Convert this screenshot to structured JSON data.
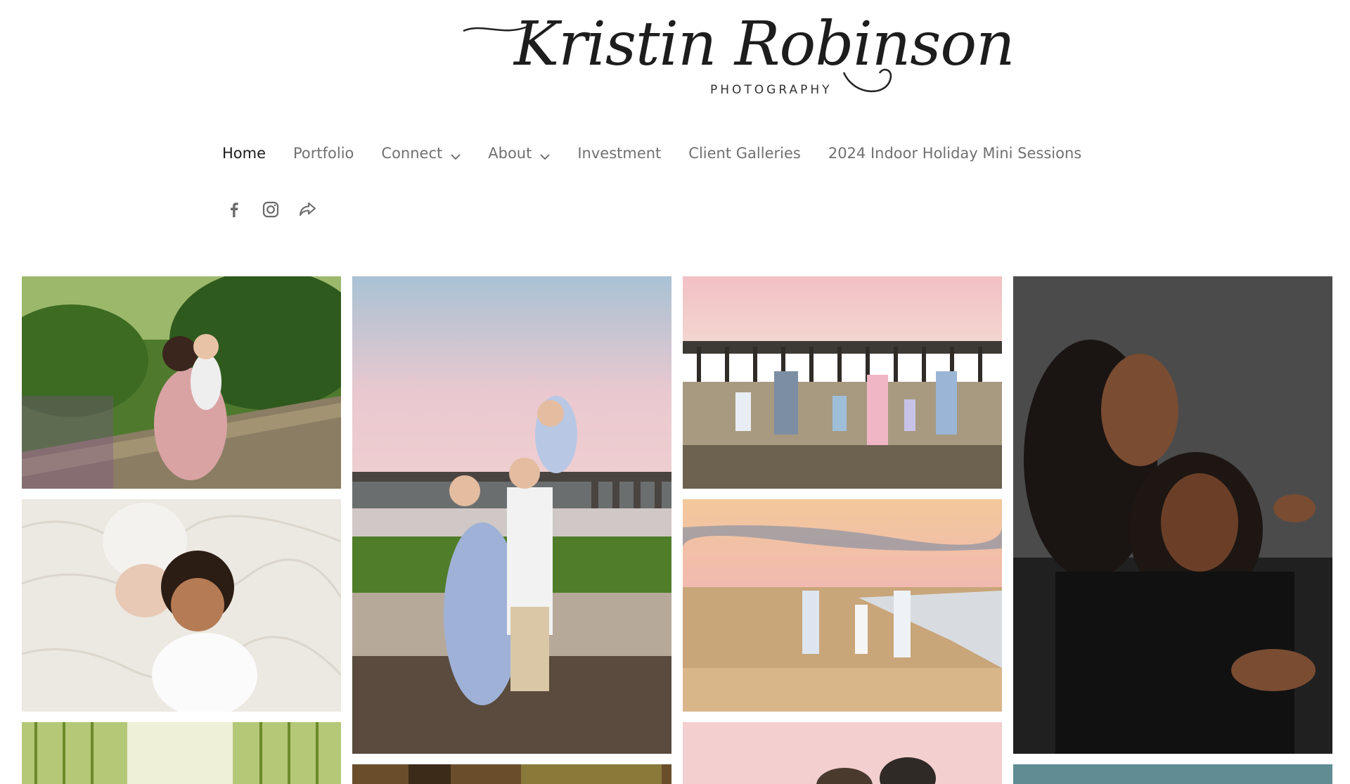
{
  "brand": {
    "name": "Kristin Robinson",
    "subtitle": "PHOTOGRAPHY"
  },
  "nav": {
    "items": [
      {
        "label": "Home",
        "active": true,
        "dropdown": false
      },
      {
        "label": "Portfolio",
        "active": false,
        "dropdown": false
      },
      {
        "label": "Connect",
        "active": false,
        "dropdown": true
      },
      {
        "label": "About",
        "active": false,
        "dropdown": true
      },
      {
        "label": "Investment",
        "active": false,
        "dropdown": false
      },
      {
        "label": "Client Galleries",
        "active": false,
        "dropdown": false
      },
      {
        "label": "2024 Indoor Holiday Mini Sessions",
        "active": false,
        "dropdown": false
      }
    ]
  },
  "social": {
    "icons": [
      "facebook-icon",
      "instagram-icon",
      "share-icon"
    ]
  },
  "gallery": {
    "photos": [
      {
        "subject": "mother-and-baby-on-stone-wall"
      },
      {
        "subject": "family-on-beach-at-sunset-with-pier"
      },
      {
        "subject": "family-of-six-at-pier-low-tide"
      },
      {
        "subject": "mother-and-daughter-studio-portrait"
      },
      {
        "subject": "newborn-and-sister-on-fur-rug"
      },
      {
        "subject": "family-of-four-walking-on-beach"
      },
      {
        "subject": "willow-tree-photo"
      },
      {
        "subject": "forest-photo"
      },
      {
        "subject": "couple-at-sunset-photo"
      },
      {
        "subject": "teal-backdrop-photo"
      }
    ]
  },
  "colors": {
    "nav_active": "#1a1a1a",
    "nav_inactive": "#707070",
    "background": "#ffffff"
  }
}
